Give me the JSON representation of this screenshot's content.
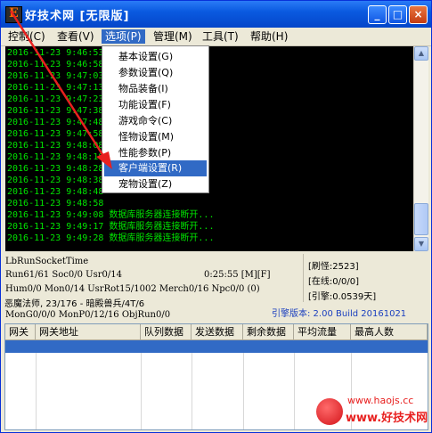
{
  "window": {
    "title": "好技术网 [无限版]",
    "icon_letter": "E"
  },
  "titlebar_buttons": {
    "minimize": "_",
    "maximize": "□",
    "close": "×"
  },
  "menubar": [
    {
      "label": "控制(C)"
    },
    {
      "label": "查看(V)"
    },
    {
      "label": "选项(P)"
    },
    {
      "label": "管理(M)"
    },
    {
      "label": "工具(T)"
    },
    {
      "label": "帮助(H)"
    }
  ],
  "options_menu": [
    "基本设置(G)",
    "参数设置(Q)",
    "物品装备(I)",
    "功能设置(F)",
    "游戏命令(C)",
    "怪物设置(M)",
    "性能参数(P)",
    "客户端设置(R)",
    "宠物设置(Z)"
  ],
  "log": [
    {
      "time": "2016-11-23 9:46:53",
      "msg": ""
    },
    {
      "time": "2016-11-23 9:46:58",
      "msg": ""
    },
    {
      "time": "2016-11-23 9:47:03",
      "msg": ""
    },
    {
      "time": "2016-11-23 9:47:13",
      "msg": ""
    },
    {
      "time": "2016-11-23 9:47:23",
      "msg": ""
    },
    {
      "time": "2016-11-23 9:47:38",
      "msg": ""
    },
    {
      "time": "2016-11-23 9:47:48",
      "msg": ""
    },
    {
      "time": "2016-11-23 9:47:58",
      "msg": ""
    },
    {
      "time": "2016-11-23 9:48:08",
      "msg": ""
    },
    {
      "time": "2016-11-23 9:48:18",
      "msg": ""
    },
    {
      "time": "2016-11-23 9:48:28",
      "msg": ""
    },
    {
      "time": "2016-11-23 9:48:38",
      "msg": ""
    },
    {
      "time": "2016-11-23 9:48:48",
      "msg": ""
    },
    {
      "time": "2016-11-23 9:48:58",
      "msg": ""
    },
    {
      "time": "2016-11-23 9:49:08",
      "msg": "数据库服务器连接断开..."
    },
    {
      "time": "2016-11-23 9:49:17",
      "msg": "数据库服务器连接断开..."
    },
    {
      "time": "2016-11-23 9:49:28",
      "msg": "数据库服务器连接断开..."
    }
  ],
  "status": {
    "socket": "LbRunSocketTime",
    "run_line": "Run61/61 Soc0/0 Usr0/14",
    "clock": "0:25:55 [M][F]",
    "hum_line": "Hum0/0 Mon0/14 UsrRot15/1002 Merch0/16 Npc0/0 (0)",
    "monster": "恶魔法师, 23/176 - 暗殿兽兵/4T/6",
    "mon_line": "MonG0/0/0 MonP0/12/16 ObjRun0/0",
    "refresh": "[刷怪:2523]",
    "online": "[在线:0/0/0]",
    "engine": "[引擎:0.0539天]",
    "version": "引擎版本: 2.00 Build 20161021"
  },
  "table": {
    "columns": [
      "网关",
      "网关地址",
      "队列数据",
      "发送数据",
      "剩余数据",
      "平均流量",
      "最高人数"
    ]
  },
  "watermark": {
    "url": "www.haojs.cc",
    "name": "www.好技术网"
  },
  "colors": {
    "log_text": "#00e400",
    "selection": "#316ac5",
    "arrow": "#e8201f"
  }
}
